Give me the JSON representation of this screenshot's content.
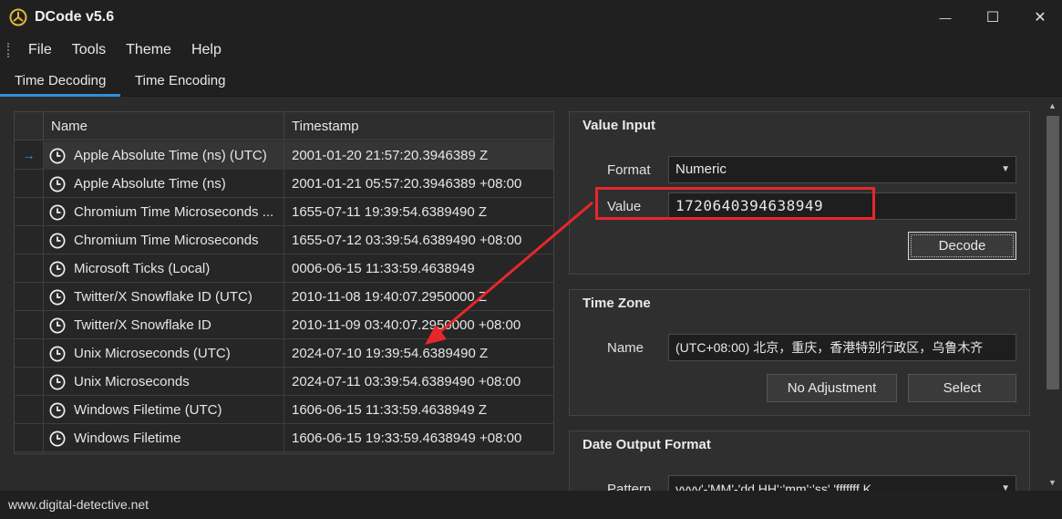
{
  "window": {
    "title": "DCode v5.6",
    "minimize_glyph": "—",
    "maximize_glyph": "☐",
    "close_glyph": "✕"
  },
  "menu": [
    "File",
    "Tools",
    "Theme",
    "Help"
  ],
  "tabs": [
    {
      "label": "Time Decoding",
      "active": true
    },
    {
      "label": "Time Encoding",
      "active": false
    }
  ],
  "grid": {
    "columns": [
      "Name",
      "Timestamp"
    ],
    "rows": [
      {
        "name": "Apple Absolute Time (ns) (UTC)",
        "timestamp": "2001-01-20 21:57:20.3946389 Z",
        "selected": true
      },
      {
        "name": "Apple Absolute Time (ns)",
        "timestamp": "2001-01-21 05:57:20.3946389 +08:00"
      },
      {
        "name": "Chromium Time Microseconds ...",
        "timestamp": "1655-07-11 19:39:54.6389490 Z"
      },
      {
        "name": "Chromium Time Microseconds",
        "timestamp": "1655-07-12 03:39:54.6389490 +08:00"
      },
      {
        "name": "Microsoft Ticks (Local)",
        "timestamp": "0006-06-15 11:33:59.4638949"
      },
      {
        "name": "Twitter/X Snowflake ID (UTC)",
        "timestamp": "2010-11-08 19:40:07.2950000 Z"
      },
      {
        "name": "Twitter/X Snowflake ID",
        "timestamp": "2010-11-09 03:40:07.2950000 +08:00"
      },
      {
        "name": "Unix Microseconds (UTC)",
        "timestamp": "2024-07-10 19:39:54.6389490 Z"
      },
      {
        "name": "Unix Microseconds",
        "timestamp": "2024-07-11 03:39:54.6389490 +08:00"
      },
      {
        "name": "Windows Filetime (UTC)",
        "timestamp": "1606-06-15 11:33:59.4638949 Z"
      },
      {
        "name": "Windows Filetime",
        "timestamp": "1606-06-15 19:33:59.4638949 +08:00"
      }
    ],
    "selection_indicator": "→"
  },
  "value_input": {
    "title": "Value Input",
    "format_label": "Format",
    "format_value": "Numeric",
    "value_label": "Value",
    "value": "1720640394638949",
    "decode_label": "Decode"
  },
  "time_zone": {
    "title": "Time Zone",
    "name_label": "Name",
    "name_value": "(UTC+08:00) 北京，重庆，香港特别行政区，乌鲁木齐",
    "no_adjustment_label": "No Adjustment",
    "select_label": "Select"
  },
  "date_output": {
    "title": "Date Output Format",
    "pattern_label": "Pattern",
    "pattern_value": "yyyy'-'MM'-'dd HH':'mm':'ss'.'fffffff K"
  },
  "status": {
    "text": "www.digital-detective.net"
  },
  "colors": {
    "accent": "#2e8fd6",
    "annotation": "#e8272b"
  }
}
